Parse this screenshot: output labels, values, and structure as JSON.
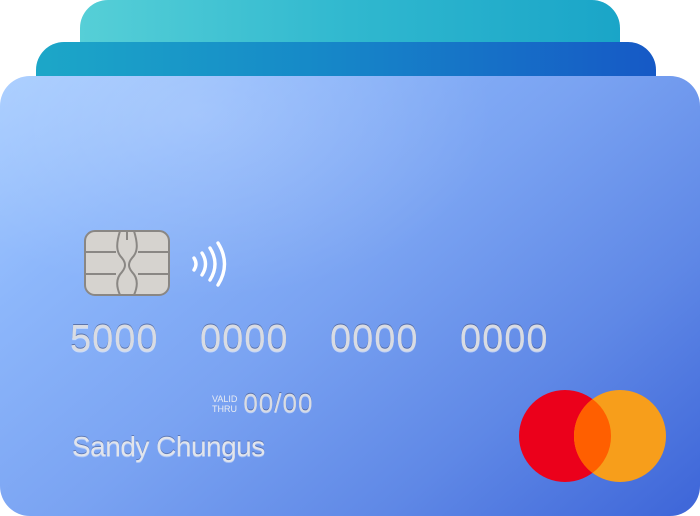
{
  "card": {
    "number_groups": [
      "5000",
      "0000",
      "0000",
      "0000"
    ],
    "valid_label_line1": "VALID",
    "valid_label_line2": "THRU",
    "expiry": "00/00",
    "cardholder_name": "Sandy Chungus",
    "brand": "mastercard"
  },
  "colors": {
    "back_card": "#30b8cf",
    "middle_card": "#1689c8",
    "front_card_light": "#a8cdff",
    "front_card_dark": "#3d65d8",
    "brand_red": "#eb001b",
    "brand_orange": "#f79e1b",
    "brand_overlap": "#ff5f00",
    "chip": "#d6d3cf"
  },
  "icons": {
    "chip": "emv-chip-icon",
    "contactless": "contactless-icon",
    "brand": "mastercard-logo"
  }
}
